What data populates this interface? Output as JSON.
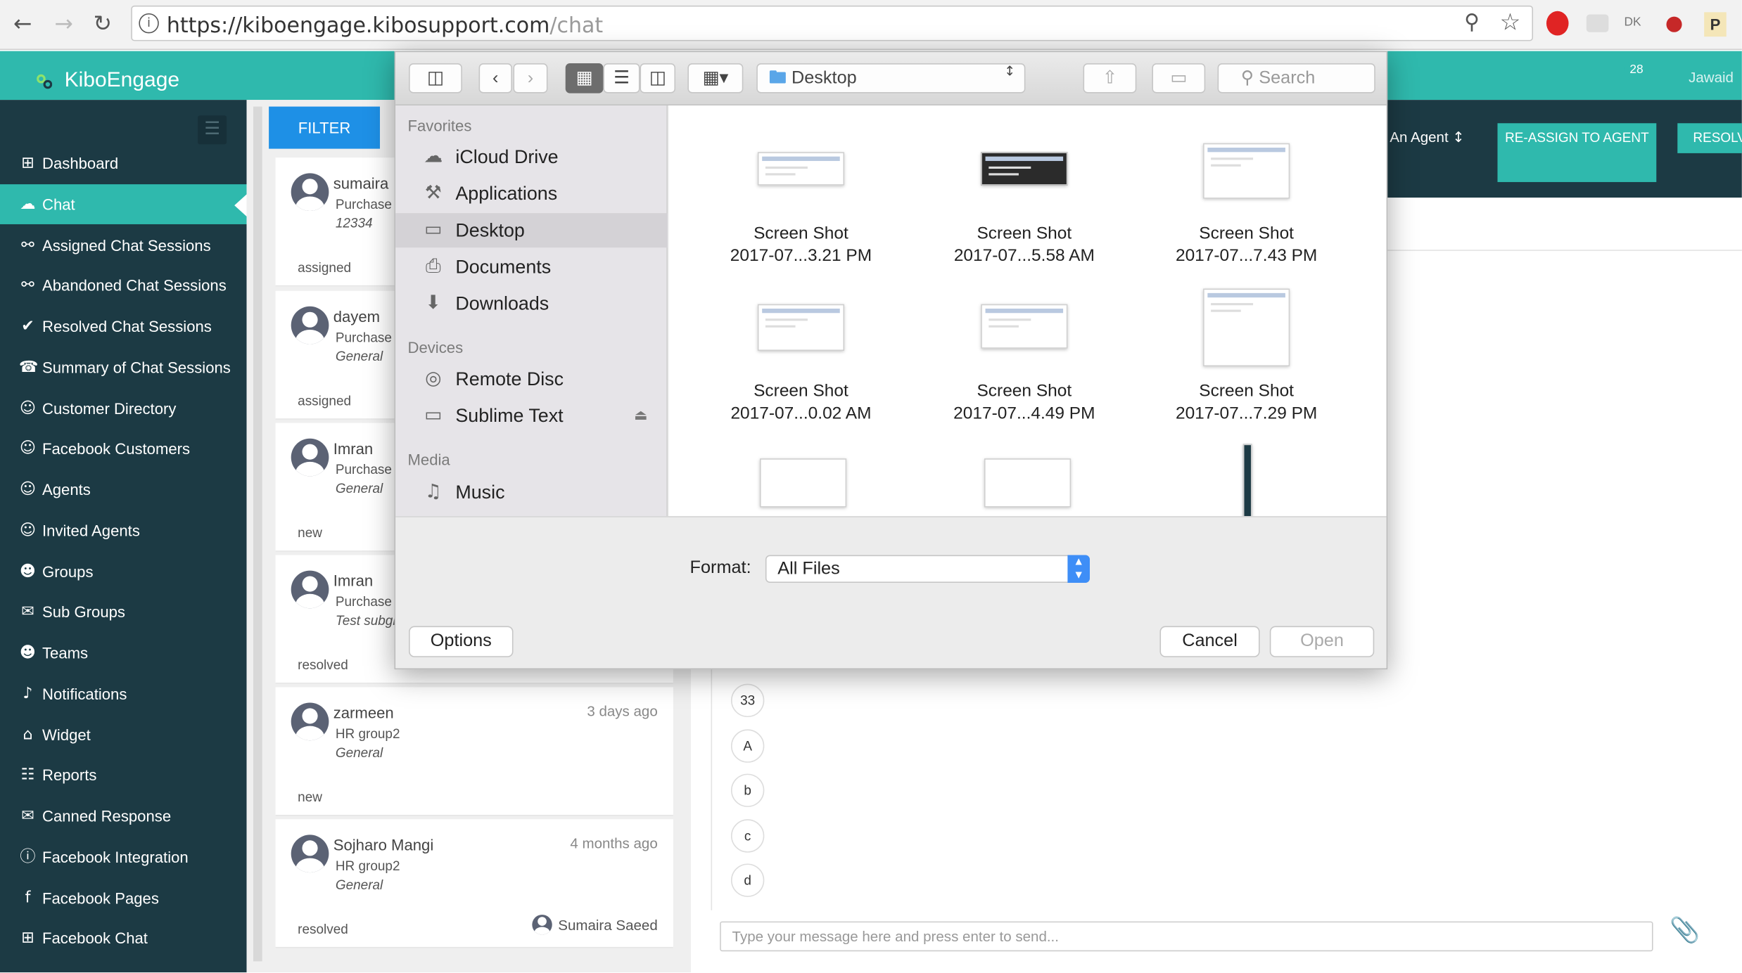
{
  "browser": {
    "url_host": "https://kiboengage.kibosupport.com",
    "url_path": "/chat",
    "back_icon": "arrow-left-icon",
    "forward_icon": "arrow-right-icon",
    "reload_icon": "reload-icon",
    "info_icon": "info-icon",
    "zoom_icon": "zoom-icon",
    "star_icon": "star-icon",
    "extension_icons": [
      "opera-icon",
      "cast-icon",
      "dk-extension-icon",
      "record-icon",
      "p-extension-icon"
    ],
    "ext_dk_label": "DK",
    "ext_p_label": "P"
  },
  "app": {
    "brand": "KiboEngage",
    "notification_count": "28",
    "user_name": "Jawaid",
    "colors": {
      "accent": "#2fb9ad",
      "sidebar": "#1c3a44",
      "filter": "#1e90e6"
    }
  },
  "sidebar": {
    "items": [
      {
        "label": "Dashboard",
        "icon": "grid-icon"
      },
      {
        "label": "Chat",
        "icon": "chat-bubble-icon",
        "active": true
      },
      {
        "label": "Assigned Chat Sessions",
        "icon": "link-icon"
      },
      {
        "label": "Abandoned Chat Sessions",
        "icon": "link-icon"
      },
      {
        "label": "Resolved Chat Sessions",
        "icon": "check-circle-icon"
      },
      {
        "label": "Summary of Chat Sessions",
        "icon": "phone-icon"
      },
      {
        "label": "Customer Directory",
        "icon": "user-icon"
      },
      {
        "label": "Facebook Customers",
        "icon": "user-icon"
      },
      {
        "label": "Agents",
        "icon": "user-icon"
      },
      {
        "label": "Invited Agents",
        "icon": "user-icon"
      },
      {
        "label": "Groups",
        "icon": "users-icon"
      },
      {
        "label": "Sub Groups",
        "icon": "envelope-icon"
      },
      {
        "label": "Teams",
        "icon": "users-icon"
      },
      {
        "label": "Notifications",
        "icon": "bell-icon"
      },
      {
        "label": "Widget",
        "icon": "tag-icon"
      },
      {
        "label": "Reports",
        "icon": "bar-chart-icon"
      },
      {
        "label": "Canned Response",
        "icon": "envelope-icon"
      },
      {
        "label": "Facebook Integration",
        "icon": "info-circle-icon"
      },
      {
        "label": "Facebook Pages",
        "icon": "facebook-icon"
      },
      {
        "label": "Facebook Chat",
        "icon": "grid-icon"
      }
    ]
  },
  "chat_list": {
    "filter_label": "FILTER",
    "items": [
      {
        "name": "sumaira",
        "group": "Purchase T",
        "subgroup": "12334",
        "status": "assigned",
        "time": "",
        "agent": ""
      },
      {
        "name": "dayem",
        "group": "Purchase T",
        "subgroup": "General",
        "status": "assigned",
        "time": "",
        "agent": ""
      },
      {
        "name": "Imran",
        "group": "Purchase T",
        "subgroup": "General",
        "status": "new",
        "time": "",
        "agent": ""
      },
      {
        "name": "Imran",
        "group": "Purchase T",
        "subgroup": "Test subgr",
        "status": "resolved",
        "time": "",
        "agent": ""
      },
      {
        "name": "zarmeen",
        "group": "HR group2",
        "subgroup": "General",
        "status": "new",
        "time": "3 days ago",
        "agent": ""
      },
      {
        "name": "Sojharo Mangi",
        "group": "HR group2",
        "subgroup": "General",
        "status": "resolved",
        "time": "4 months ago",
        "agent": "Sumaira Saeed"
      }
    ]
  },
  "conversation": {
    "agent_select": "An Agent",
    "reassign_label": "RE-ASSIGN TO AGENT",
    "resolve_label": "RESOLVE",
    "options": [
      "33",
      "A",
      "b",
      "c",
      "d"
    ],
    "message_placeholder": "Type your message here and press enter to send...",
    "attach_icon": "paperclip-icon"
  },
  "dialog": {
    "location": "Desktop",
    "search_placeholder": "Search",
    "sidebar": {
      "favorites_header": "Favorites",
      "favorites": [
        {
          "label": "iCloud Drive",
          "icon": "cloud-icon"
        },
        {
          "label": "Applications",
          "icon": "applications-icon"
        },
        {
          "label": "Desktop",
          "icon": "desktop-icon",
          "selected": true
        },
        {
          "label": "Documents",
          "icon": "documents-icon"
        },
        {
          "label": "Downloads",
          "icon": "downloads-icon"
        }
      ],
      "devices_header": "Devices",
      "devices": [
        {
          "label": "Remote Disc",
          "icon": "disc-icon"
        },
        {
          "label": "Sublime Text",
          "icon": "drive-icon"
        }
      ],
      "media_header": "Media",
      "media": [
        {
          "label": "Music",
          "icon": "music-icon"
        }
      ]
    },
    "files": [
      {
        "line1": "Screen Shot",
        "line2": "2017-07...3.21 PM"
      },
      {
        "line1": "Screen Shot",
        "line2": "2017-07...5.58 AM"
      },
      {
        "line1": "Screen Shot",
        "line2": "2017-07...7.43 PM"
      },
      {
        "line1": "Screen Shot",
        "line2": "2017-07...0.02 AM"
      },
      {
        "line1": "Screen Shot",
        "line2": "2017-07...4.49 PM"
      },
      {
        "line1": "Screen Shot",
        "line2": "2017-07...7.29 PM"
      }
    ],
    "format_label": "Format:",
    "format_value": "All Files",
    "options_label": "Options",
    "cancel_label": "Cancel",
    "open_label": "Open"
  }
}
